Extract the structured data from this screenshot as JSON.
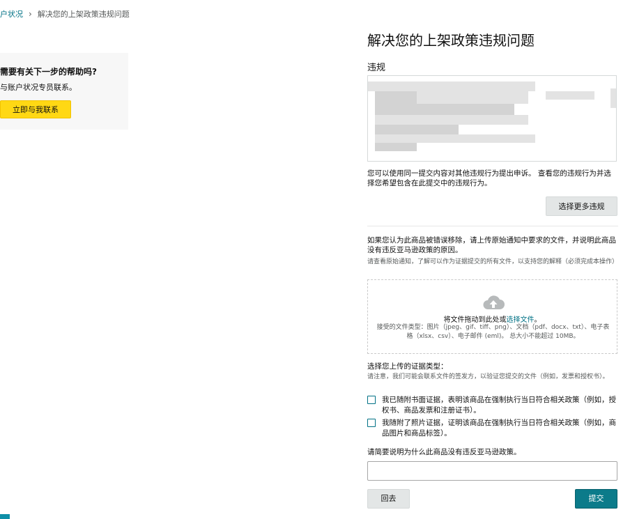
{
  "breadcrumb": {
    "parent": "户状况",
    "separator": "›",
    "current": "解决您的上架政策违规问题"
  },
  "help": {
    "heading": "需要有关下一步的帮助吗?",
    "text": "与账户状况专员联系。",
    "contact_button": "立即与我联系"
  },
  "main": {
    "title": "解决您的上架政策违规问题",
    "violations_label": "违规",
    "appeal_note": "您可以使用同一提交内容对其他违规行为提出申诉。 查看您的违规行为并选择您希望包含在此提交中的违规行为。",
    "select_more_button": "选择更多违规",
    "upload_intro": "如果您认为此商品被错误移除，请上传原始通知中要求的文件，并说明此商品没有违反亚马逊政策的原因。",
    "upload_hint": "请查看原始通知，了解可以作为证据提交的所有文件，以支持您的解释（必须完成本操作）",
    "dropzone": {
      "text_before": "将文件拖动到此处或",
      "link": "选择文件",
      "text_after": "。",
      "accepted": "接受的文件类型：图片（jpeg、gif、tiff、png）、文档（pdf、docx、txt）、电子表格（xlsx、csv）、电子邮件 (eml)。 总大小不能超过 10MB。"
    },
    "evidence_label": "选择您上传的证据类型：",
    "evidence_note": "请注意，我们可能会联系文件的签发方，以验证您提交的文件（例如，发票和授权书）。",
    "options": [
      {
        "label": "我已随附书面证据，表明该商品在强制执行当日符合相关政策（例如，授权书、商品发票和注册证书）。"
      },
      {
        "label": "我随附了照片证据，证明该商品在强制执行当日符合相关政策（例如，商品图片和商品标签）。"
      }
    ],
    "explain_label": "请简要说明为什么此商品没有违反亚马逊政策。",
    "explain_value": "",
    "back_button": "回去",
    "submit_button": "提交"
  },
  "colors": {
    "link": "#007185",
    "primary_button": "#0c7b8a",
    "contact_button": "#ffd814",
    "help_panel": "#f7f7f7"
  },
  "icons": [
    "upload-cloud-icon"
  ]
}
